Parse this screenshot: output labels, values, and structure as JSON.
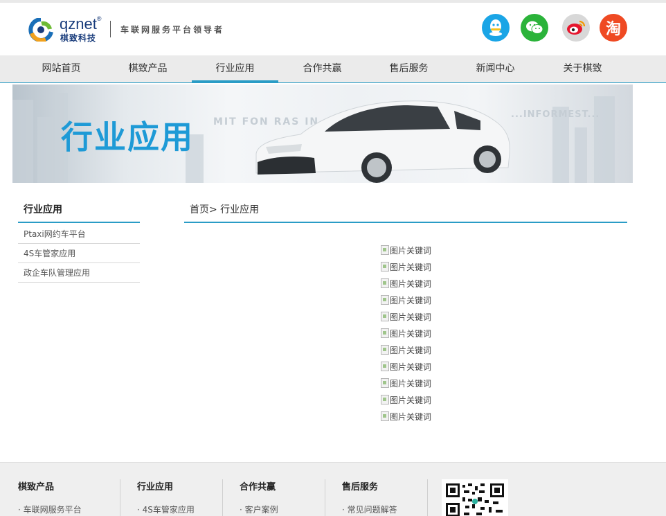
{
  "header": {
    "logo_word": "qznet",
    "logo_tm": "®",
    "logo_cn": "棋致科技",
    "slogan": "车联网服务平台领导者",
    "social": {
      "qq": "qq-icon",
      "wechat": "wechat-icon",
      "weibo": "weibo-icon",
      "taobao_label": "淘"
    }
  },
  "nav": {
    "items": [
      "网站首页",
      "棋致产品",
      "行业应用",
      "合作共赢",
      "售后服务",
      "新闻中心",
      "关于棋致"
    ],
    "active_index": 2,
    "accent_color": "#2a9cc6"
  },
  "banner": {
    "title": "行业应用",
    "faint_text_1": "MIT FON RAS IN",
    "faint_text_2": "...INFORMEST...",
    "title_color": "#1e9ad6"
  },
  "sidebar": {
    "title": "行业应用",
    "items": [
      "Ptaxi网约车平台",
      "4S车管家应用",
      "政企车队管理应用"
    ]
  },
  "main": {
    "breadcrumb": "首页> 行业应用",
    "image_alts": [
      "图片关键词",
      "图片关键词",
      "图片关键词",
      "图片关键词",
      "图片关键词",
      "图片关键词",
      "图片关键词",
      "图片关键词",
      "图片关键词",
      "图片关键词",
      "图片关键词"
    ]
  },
  "footer": {
    "columns": [
      {
        "heading": "棋致产品",
        "link": "· 车联网服务平台"
      },
      {
        "heading": "行业应用",
        "link": "· 4S车管家应用"
      },
      {
        "heading": "合作共赢",
        "link": "· 客户案例"
      },
      {
        "heading": "售后服务",
        "link": "· 常见问题解答"
      }
    ],
    "qr_icon": "qr-code-icon"
  }
}
